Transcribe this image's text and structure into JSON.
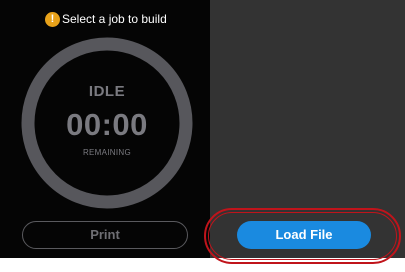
{
  "status": {
    "icon": "warning-icon",
    "icon_glyph": "!",
    "message": "Select a job to build"
  },
  "gauge": {
    "state": "IDLE",
    "time": "00:00",
    "label": "REMAINING"
  },
  "buttons": {
    "print_label": "Print",
    "load_label": "Load File"
  },
  "colors": {
    "left_panel": "#050505",
    "right_panel": "#333333",
    "gauge_ring": "#57575c",
    "warning": "#e8a21a",
    "primary_button": "#1a8ae0",
    "highlight": "#c0141b",
    "muted_text": "#7a7a80"
  }
}
